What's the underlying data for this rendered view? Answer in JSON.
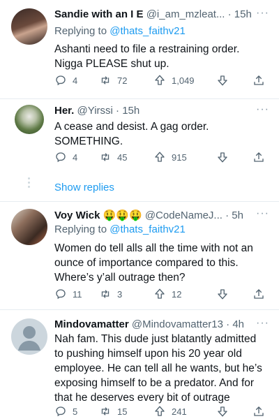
{
  "tweets": [
    {
      "name": "Sandie with an I E",
      "handle": "@i_am_mzleat...",
      "time": "· 15h",
      "replying_prefix": "Replying to ",
      "replying_to": "@thats_faithv21",
      "text_lines": [
        "Ashanti need to file a restraining order.",
        "Nigga PLEASE shut up."
      ],
      "replies": "4",
      "retweets": "72",
      "likes": "1,049"
    },
    {
      "name": "Her.",
      "handle": "@Yirssi",
      "time": "· 15h",
      "text_lines": [
        "A cease and desist. A gag order.",
        "SOMETHING."
      ],
      "replies": "4",
      "retweets": "45",
      "likes": "915"
    },
    {
      "name": "Voy Wick",
      "emojis": "🤑🤑🤑",
      "handle": "@CodeNameJ...",
      "time": "· 5h",
      "replying_prefix": "Replying to ",
      "replying_to": "@thats_faithv21",
      "text_lines": [
        "Women do tell alls all the time with not an",
        "ounce of importance compared to this.",
        "Where’s y’all outrage then?"
      ],
      "replies": "11",
      "retweets": "3",
      "likes": "12"
    },
    {
      "name": "Mindovamatter",
      "handle": "@Mindovamatter13",
      "time": "· 4h",
      "text_lines": [
        "Nah fam. This dude just blatantly admitted",
        "to pushing himself upon his 20 year old",
        "employee. He can tell all he wants, but he’s",
        "exposing himself to be a predator. And for",
        "that he deserves every bit of outrage"
      ],
      "replies": "5",
      "retweets": "15",
      "likes": "241"
    }
  ],
  "show_replies": "Show replies",
  "more_label": "···",
  "colors": {
    "link": "#1d9bf0",
    "secondary": "#536471",
    "divider": "#e6ecf0"
  }
}
